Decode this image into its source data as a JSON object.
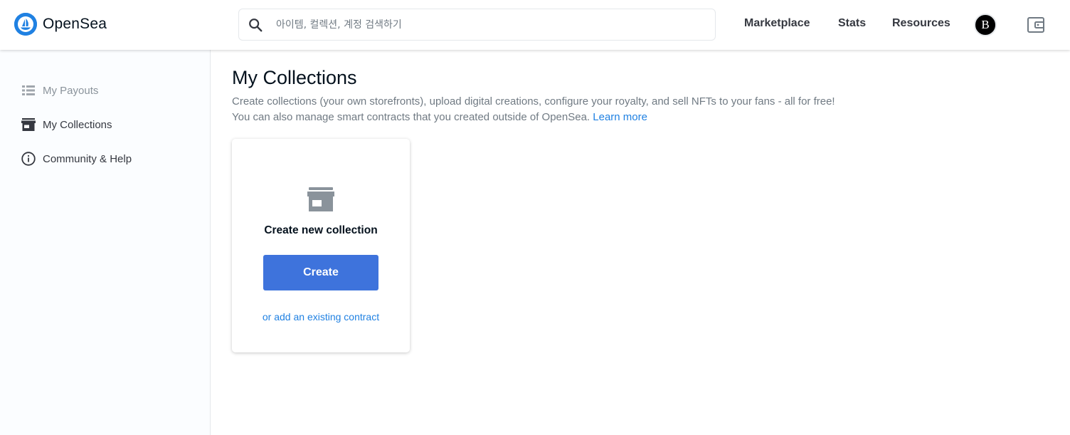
{
  "colors": {
    "brand": "#2081e2",
    "button": "#3e73dc",
    "text_primary": "#04111d",
    "text_muted": "#707a83",
    "sidebar_bg": "#fbfdff"
  },
  "header": {
    "logo_text": "OpenSea",
    "logo_icon": "opensea-logo-icon",
    "search": {
      "icon": "search-icon",
      "placeholder": "아이템, 컬렉션, 계정 검색하기",
      "value": ""
    },
    "nav": {
      "marketplace": "Marketplace",
      "stats": "Stats",
      "resources": "Resources"
    },
    "avatar_letter": "B",
    "wallet_icon": "wallet-icon"
  },
  "sidebar": {
    "items": [
      {
        "label": "My Payouts",
        "icon": "list-icon"
      },
      {
        "label": "My Collections",
        "icon": "storefront-icon"
      },
      {
        "label": "Community & Help",
        "icon": "info-icon"
      }
    ]
  },
  "main": {
    "title": "My Collections",
    "description_line1": "Create collections (your own storefronts), upload digital creations, configure your royalty, and sell NFTs to your fans - all for free!",
    "description_line2": "You can also manage smart contracts that you created outside of OpenSea.",
    "learn_more": "Learn more",
    "card": {
      "icon": "storefront-icon",
      "title": "Create new collection",
      "button_label": "Create",
      "existing_link": "or add an existing contract"
    }
  }
}
